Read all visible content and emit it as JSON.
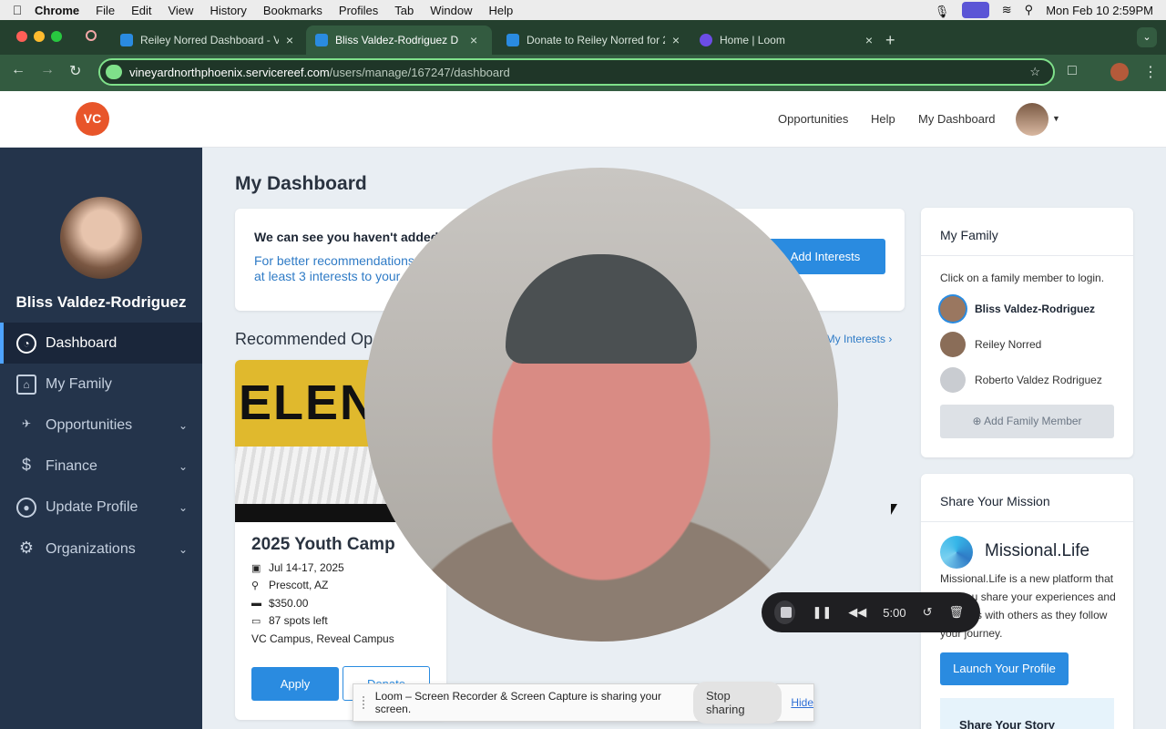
{
  "menubar": {
    "app": "Chrome",
    "items": [
      "File",
      "Edit",
      "View",
      "History",
      "Bookmarks",
      "Profiles",
      "Tab",
      "Window",
      "Help"
    ],
    "clock": "Mon Feb 10  2:59PM"
  },
  "tabs": [
    {
      "title": "Reiley Norred Dashboard - Vi",
      "active": false
    },
    {
      "title": "Bliss Valdez-Rodriguez D",
      "active": true
    },
    {
      "title": "Donate to Reiley Norred for 2",
      "active": false
    },
    {
      "title": "Home | Loom",
      "active": false
    }
  ],
  "address": {
    "host": "vineyardnorthphoenix.servicereef.com",
    "path": "/users/manage/167247/dashboard"
  },
  "site_header": {
    "logo_text": "VC",
    "nav": [
      "Opportunities",
      "Help",
      "My Dashboard"
    ]
  },
  "sidebar": {
    "user_name": "Bliss Valdez-Rodriguez",
    "items": [
      {
        "label": "Dashboard",
        "icon": "gauge-icon",
        "active": true
      },
      {
        "label": "My Family",
        "icon": "home-icon"
      },
      {
        "label": "Opportunities",
        "icon": "plane-icon"
      },
      {
        "label": "Finance",
        "icon": "dollar-icon"
      },
      {
        "label": "Update Profile",
        "icon": "user-icon"
      },
      {
        "label": "Organizations",
        "icon": "gear-icon"
      }
    ]
  },
  "main": {
    "title": "My Dashboard",
    "interests": {
      "heading": "We can see you haven't added a",
      "body": "For better recommendations at least 3 interests to your",
      "button": "Add Interests"
    },
    "recommended_title": "Recommended Op",
    "interests_link": "t My Interests",
    "opportunity": {
      "image_text": "ELENT",
      "title": "2025 Youth Camp",
      "date": "Jul 14-17, 2025",
      "location": "Prescott, AZ",
      "price": "$350.00",
      "spots": "87 spots left",
      "venue": "VC Campus, Reveal Campus",
      "apply": "Apply",
      "donate": "Donate"
    }
  },
  "family": {
    "title": "My Family",
    "hint": "Click on a family member to login.",
    "members": [
      "Bliss Valdez-Rodriguez",
      "Reiley Norred",
      "Roberto Valdez Rodriguez"
    ],
    "add_button": "Add Family Member"
  },
  "mission": {
    "title": "Share Your Mission",
    "brand": "Missional.Life",
    "description": "Missional.Life is a new platform that lets you share your experiences and activities with others as they follow your journey.",
    "launch_button": "Launch Your Profile",
    "story_title": "Share Your Story"
  },
  "loom": {
    "timer": "5:00",
    "share_text": "Loom – Screen Recorder & Screen Capture is sharing your screen.",
    "stop_label": "Stop sharing",
    "hide_label": "Hide"
  },
  "colors": {
    "accent": "#2a8be0",
    "sidebar": "#24344b",
    "logo": "#e8552a"
  }
}
